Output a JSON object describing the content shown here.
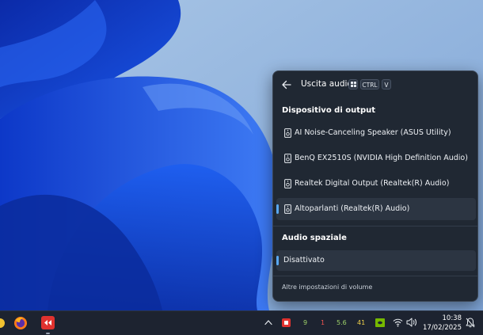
{
  "flyout": {
    "title": "Uscita audio",
    "shortcut_keys": [
      "CTRL",
      "V"
    ],
    "output_section_title": "Dispositivo di output",
    "devices": [
      {
        "label": "AI Noise-Canceling Speaker (ASUS Utility)",
        "icon": "speaker-icon",
        "selected": false
      },
      {
        "label": "BenQ EX2510S (NVIDIA High Definition Audio)",
        "icon": "speaker-icon",
        "selected": false
      },
      {
        "label": "Realtek Digital Output (Realtek(R) Audio)",
        "icon": "speaker-icon",
        "selected": false
      },
      {
        "label": "Altoparlanti (Realtek(R) Audio)",
        "icon": "speaker-icon",
        "selected": true
      }
    ],
    "spatial_section_title": "Audio spaziale",
    "spatial_value": "Disattivato",
    "more_settings_link": "Altre impostazioni di volume"
  },
  "taskbar": {
    "tray_numbers": [
      "9",
      "1",
      "5.6",
      "41"
    ],
    "time": "10:38",
    "date": "17/02/2025"
  },
  "colors": {
    "accent": "#59a8f0",
    "flyout_bg": "#202833",
    "taskbar_bg": "#1d2330"
  }
}
